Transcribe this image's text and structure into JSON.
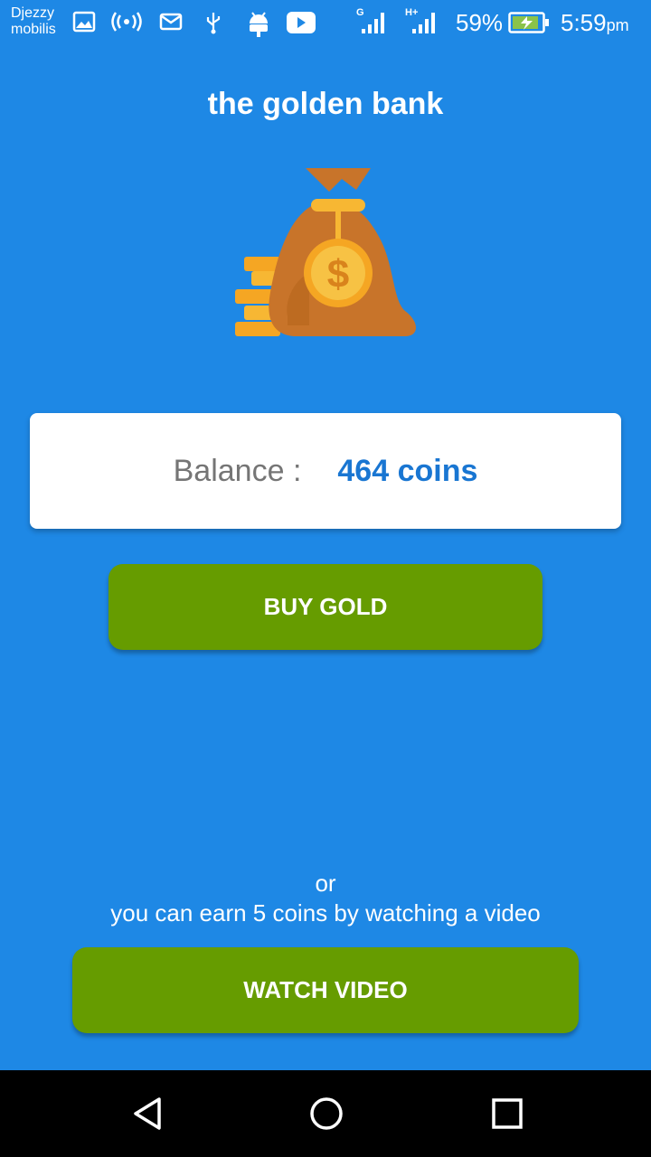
{
  "status_bar": {
    "carrier_line1": "Djezzy",
    "carrier_line2": "mobilis",
    "icons": [
      "image-icon",
      "hotspot-icon",
      "mail-icon",
      "usb-icon",
      "android-icon",
      "youtube-icon",
      "signal-g-icon",
      "signal-h-icon",
      "battery-charging-icon"
    ],
    "net1": "G",
    "net2": "H+",
    "battery": "59%",
    "time": "5:59",
    "time_suffix": "pm"
  },
  "app": {
    "title": "the golden bank",
    "illustration": "money-bag-icon"
  },
  "balance": {
    "label": "Balance :",
    "value": "464 coins"
  },
  "buttons": {
    "buy": "BUY GOLD",
    "watch": "WATCH VIDEO"
  },
  "info": {
    "or": "or",
    "earn": "you can earn 5 coins by watching a video"
  },
  "nav": {
    "back": "back-icon",
    "home": "home-icon",
    "recents": "recents-icon"
  },
  "colors": {
    "background": "#1e88e5",
    "button": "#669c00",
    "balance_value": "#1976d2"
  }
}
